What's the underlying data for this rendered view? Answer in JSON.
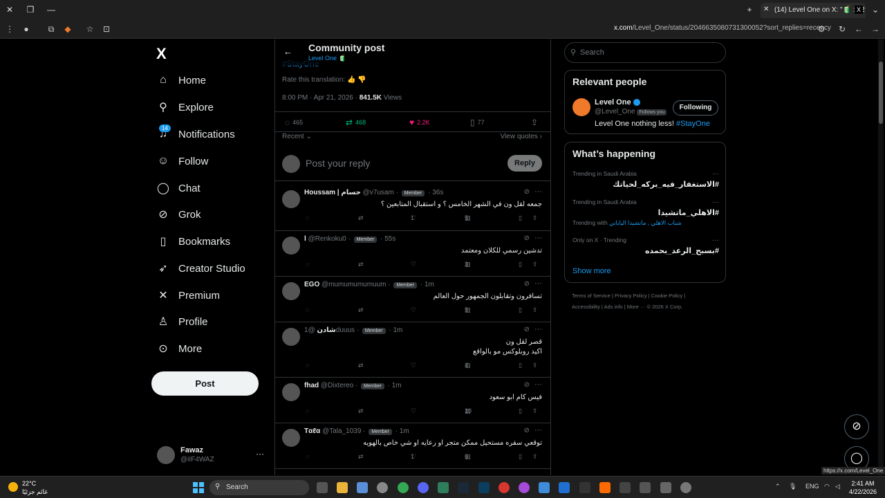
{
  "browser": {
    "tab_title": "(14) Level One on X: \"🧃 : 22 A...",
    "url_domain": "x.com",
    "url_path": "/Level_One/status/2046635080731300052?sort_replies=recency"
  },
  "sidebar": {
    "logo": "X",
    "items": [
      {
        "label": "Home",
        "icon": "home-icon"
      },
      {
        "label": "Explore",
        "icon": "search-icon"
      },
      {
        "label": "Notifications",
        "icon": "bell-icon",
        "badge": "14"
      },
      {
        "label": "Follow",
        "icon": "person-plus-icon"
      },
      {
        "label": "Chat",
        "icon": "chat-icon"
      },
      {
        "label": "Grok",
        "icon": "grok-icon"
      },
      {
        "label": "Bookmarks",
        "icon": "bookmark-icon"
      },
      {
        "label": "Creator Studio",
        "icon": "rocket-icon"
      },
      {
        "label": "Premium",
        "icon": "x-icon"
      },
      {
        "label": "Profile",
        "icon": "person-icon"
      },
      {
        "label": "More",
        "icon": "more-circle-icon"
      }
    ],
    "post_button": "Post",
    "account": {
      "name": "Fawaz",
      "handle": "@iIF4WAZ"
    }
  },
  "main": {
    "title": "Community post",
    "subtitle": "Level One 🧃",
    "hashtag": "#StayOne",
    "rate_translation": "Rate this translation:",
    "meta_time": "8:00 PM · Apr 21, 2026 · ",
    "views_count": "841.5K",
    "views_label": " Views",
    "stats": {
      "replies": "465",
      "reposts": "468",
      "likes": "2.2K",
      "bookmarks": "77"
    },
    "sort": "Recent",
    "view_quotes": "View quotes",
    "reply_placeholder": "Post your reply",
    "reply_button": "Reply",
    "replies": [
      {
        "name": "Houssam | حسام",
        "handle": "@v7usam",
        "badge": "Member",
        "time": "36s",
        "text": "جمعه لقل ون في الشهر الخامس ؟ و استقبال المتابعين ؟",
        "comments": "",
        "reposts": "",
        "likes": "1",
        "views": "5"
      },
      {
        "name": "l",
        "handle": "@Renkoku0",
        "badge": "Member",
        "time": "55s",
        "text": "تدشين رسمي للكلان ومعتمد",
        "comments": "",
        "reposts": "",
        "likes": "",
        "views": "3"
      },
      {
        "name": "EGO",
        "handle": "@mumumumumuum",
        "badge": "Member",
        "time": "1m",
        "text": "تسافرون وتقابلون الجمهور حول العالم",
        "comments": "",
        "reposts": "",
        "likes": "",
        "views": "5"
      },
      {
        "name": "شادن",
        "handle": "@1duuus",
        "badge": "Member",
        "time": "1m",
        "text": "قصر لقل ون",
        "text2": "اكيد روبلوكس مو بالواقع",
        "comments": "",
        "reposts": "",
        "likes": "",
        "views": "4"
      },
      {
        "name": "fhad",
        "handle": "@Dixtereo",
        "badge": "Member",
        "time": "1m",
        "text": "فيس كام ابو سعود",
        "comments": "",
        "reposts": "",
        "likes": "",
        "views": "10"
      },
      {
        "name": "Tαℓα",
        "handle": "@Tala_1039",
        "badge": "Member",
        "time": "1m",
        "text": "توقعي سفره مستحيل ممكن متجر او رعايه او شي خاص بالهويه",
        "comments": "",
        "reposts": "",
        "likes": "1",
        "views": "6"
      }
    ]
  },
  "right": {
    "search_placeholder": "Search",
    "relevant_title": "Relevant people",
    "person": {
      "name": "Level One",
      "handle": "@Level_One",
      "follows_you": "Follows you",
      "button": "Following",
      "bio": "Level One nothing less! ",
      "bio_hashtag": "#StayOne"
    },
    "happening_title": "What’s happening",
    "trends": [
      {
        "category": "Trending in Saudi Arabia",
        "name": "#الاستغفار_فيه_بركه_لحياتك"
      },
      {
        "category": "Trending in Saudi Arabia",
        "name": "#الاهلي_ماتشيدا",
        "with_label": "Trending with ",
        "with": "شباب الاهلي , ماتشيدا الياباني"
      },
      {
        "category": "Only on X · Trending",
        "name": "#بسبح_الرعد_بحمده"
      }
    ],
    "show_more": "Show more",
    "footer1": "Terms of Service  |  Privacy Policy  |  Cookie Policy  |",
    "footer2": "Accessibility  |  Ads info  |  More ···   © 2026 X Corp."
  },
  "status_url": "https://x.com/Level_One",
  "taskbar": {
    "temp": "22°C",
    "weather_text": "غائم جزئيًا",
    "search": "Search",
    "lang": "ENG",
    "time": "2:41 AM",
    "date": "4/22/2026"
  },
  "colors": {
    "accent": "#1d9bf0",
    "like": "#f91880",
    "repost": "#00ba7c"
  }
}
